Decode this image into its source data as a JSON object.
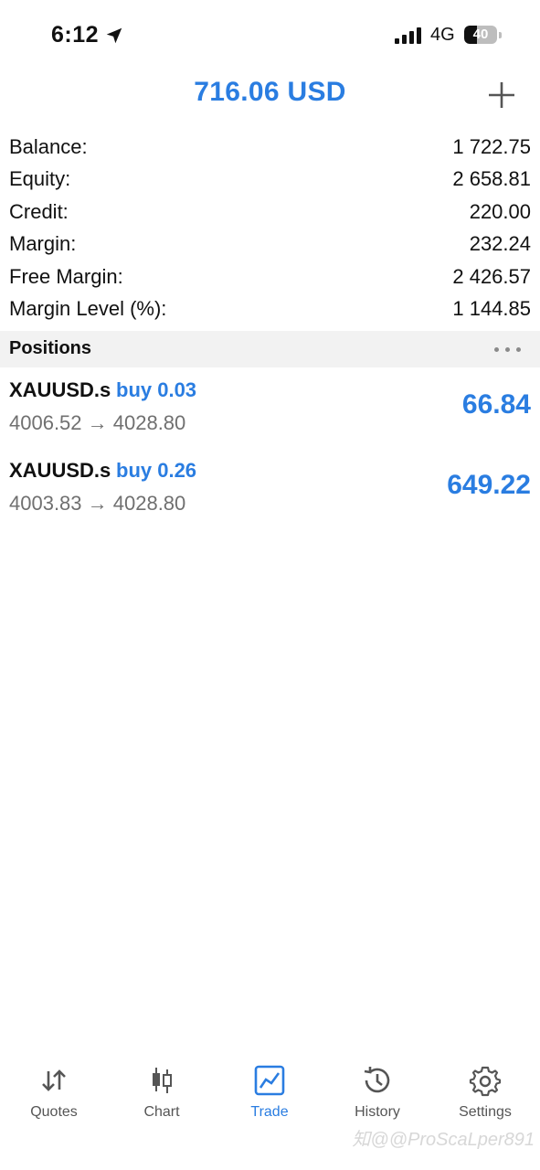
{
  "status_bar": {
    "time": "6:12",
    "network": "4G",
    "battery_percent": "40",
    "battery_level": 0.4
  },
  "header": {
    "title": "716.06 USD",
    "add_icon": "plus-icon"
  },
  "summary": [
    {
      "label": "Balance:",
      "value": "1 722.75"
    },
    {
      "label": "Equity:",
      "value": "2 658.81"
    },
    {
      "label": "Credit:",
      "value": "220.00"
    },
    {
      "label": "Margin:",
      "value": "232.24"
    },
    {
      "label": "Free Margin:",
      "value": "2 426.57"
    },
    {
      "label": "Margin Level (%):",
      "value": "1 144.85"
    }
  ],
  "positions": {
    "title": "Positions",
    "more_icon": "more-horizontal-icon",
    "items": [
      {
        "symbol": "XAUUSD.s",
        "side": "buy 0.03",
        "prices": "4006.52 → 4028.80",
        "profit": "66.84"
      },
      {
        "symbol": "XAUUSD.s",
        "side": "buy 0.26",
        "prices": "4003.83 → 4028.80",
        "profit": "649.22"
      }
    ]
  },
  "tabs": [
    {
      "label": "Quotes",
      "icon": "quotes-arrows-icon"
    },
    {
      "label": "Chart",
      "icon": "candlestick-icon"
    },
    {
      "label": "Trade",
      "icon": "trade-chart-icon",
      "active": true
    },
    {
      "label": "History",
      "icon": "history-icon"
    },
    {
      "label": "Settings",
      "icon": "gear-icon"
    }
  ],
  "watermark": "知@@ProScaLper891",
  "colors": {
    "accent": "#2a7de1",
    "text": "#111111",
    "muted": "#707070",
    "section_bg": "#f2f2f2"
  }
}
